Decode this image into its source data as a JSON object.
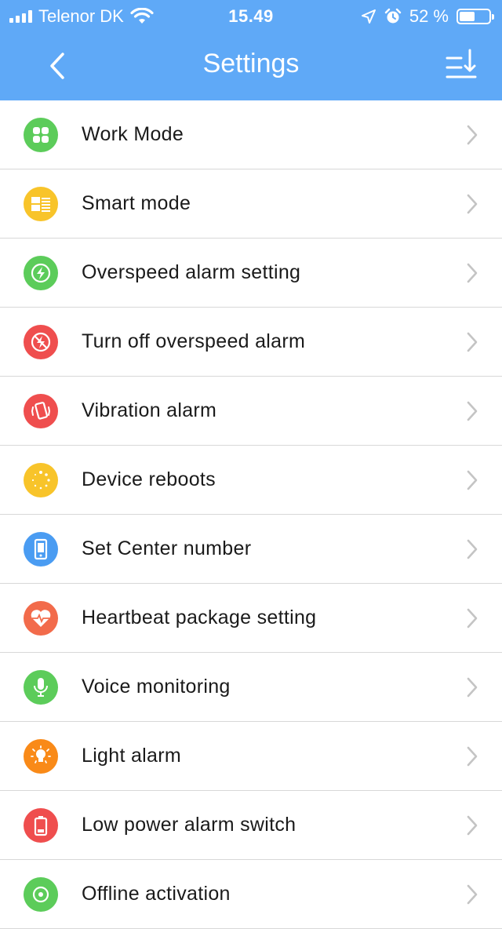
{
  "status_bar": {
    "carrier": "Telenor DK",
    "time": "15.49",
    "battery": "52 %",
    "battery_level": 0.52
  },
  "nav": {
    "title": "Settings",
    "back_icon": "chevron-left-icon",
    "sort_icon": "sort-download-icon"
  },
  "colors": {
    "header": "#5fa9f7",
    "green": "#5ccc5a",
    "yellow": "#f8c42a",
    "red": "#ef4e4e",
    "blue": "#4a9cf2",
    "orange_red": "#f26b4b",
    "orange": "#f98a18"
  },
  "items": [
    {
      "label": "Work Mode",
      "icon": "apps-grid-icon",
      "color": "#5ccc5a"
    },
    {
      "label": "Smart mode",
      "icon": "smart-layout-icon",
      "color": "#f8c42a"
    },
    {
      "label": "Overspeed alarm setting",
      "icon": "lightning-icon",
      "color": "#5ccc5a"
    },
    {
      "label": "Turn off overspeed alarm",
      "icon": "lightning-off-icon",
      "color": "#ef4e4e"
    },
    {
      "label": "Vibration alarm",
      "icon": "phone-vibrate-icon",
      "color": "#ef4e4e"
    },
    {
      "label": "Device reboots",
      "icon": "loading-dots-icon",
      "color": "#f8c42a"
    },
    {
      "label": "Set Center number",
      "icon": "mobile-phone-icon",
      "color": "#4a9cf2"
    },
    {
      "label": "Heartbeat package setting",
      "icon": "heartbeat-icon",
      "color": "#f26b4b"
    },
    {
      "label": "Voice monitoring",
      "icon": "microphone-icon",
      "color": "#5ccc5a"
    },
    {
      "label": "Light alarm",
      "icon": "light-bulb-icon",
      "color": "#f98a18"
    },
    {
      "label": "Low power alarm switch",
      "icon": "low-battery-icon",
      "color": "#ef4e4e"
    },
    {
      "label": "Offline activation",
      "icon": "offline-icon",
      "color": "#5ccc5a"
    }
  ]
}
